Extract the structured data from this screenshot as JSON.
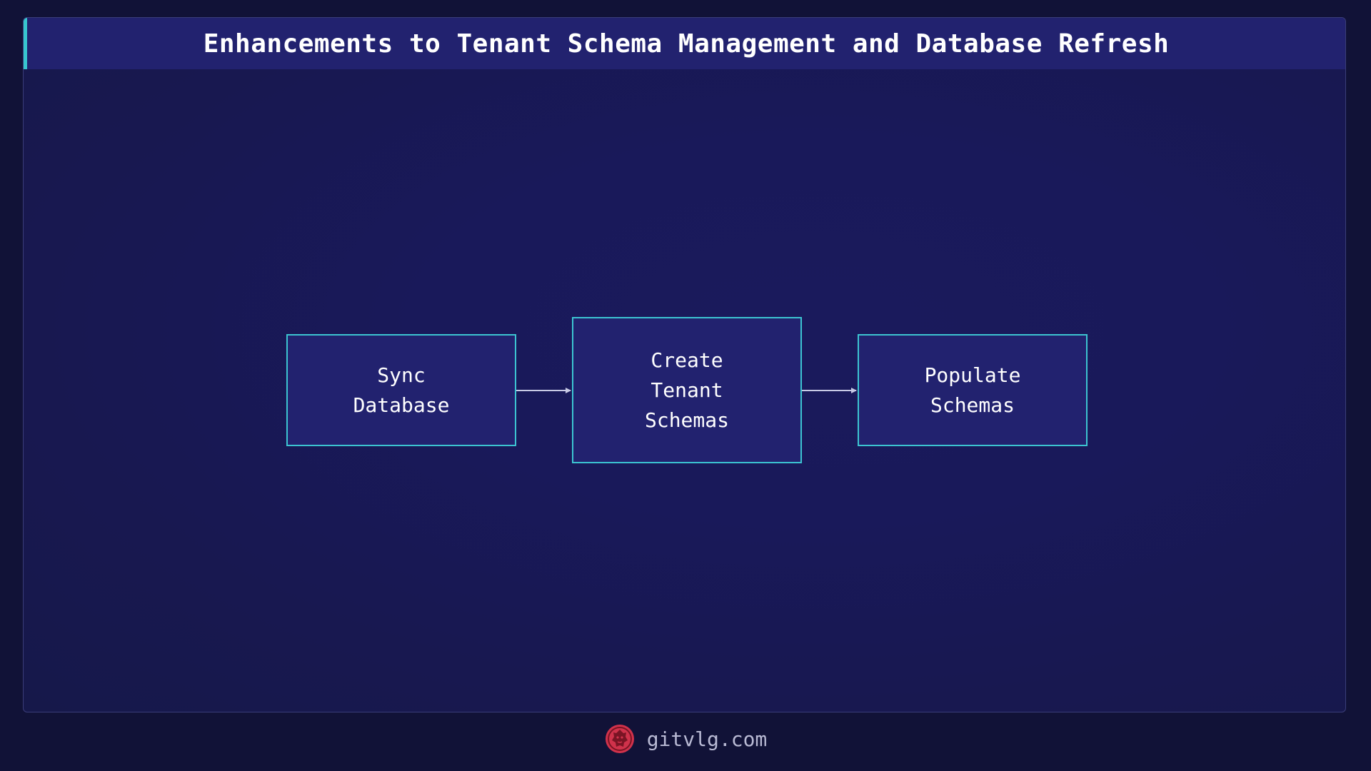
{
  "diagram": {
    "title": "Enhancements to Tenant Schema Management and Database Refresh",
    "nodes": [
      {
        "id": "sync-database",
        "lines": [
          "Sync",
          "Database"
        ]
      },
      {
        "id": "create-tenant-schemas",
        "lines": [
          "Create",
          "Tenant",
          "Schemas"
        ]
      },
      {
        "id": "populate-schemas",
        "lines": [
          "Populate",
          "Schemas"
        ]
      }
    ],
    "edges": [
      {
        "from": "sync-database",
        "to": "create-tenant-schemas"
      },
      {
        "from": "create-tenant-schemas",
        "to": "populate-schemas"
      }
    ]
  },
  "footer": {
    "site": "gitvlg.com",
    "logo_icon": "lion-emblem-icon"
  },
  "colors": {
    "background": "#111237",
    "panel": "#1a1a5c",
    "header": "#22226f",
    "accent": "#37c6cf",
    "node_fill": "#22226f",
    "node_border": "#3cc4d1",
    "arrow": "#c9cbe6",
    "logo_red": "#d0324b"
  }
}
